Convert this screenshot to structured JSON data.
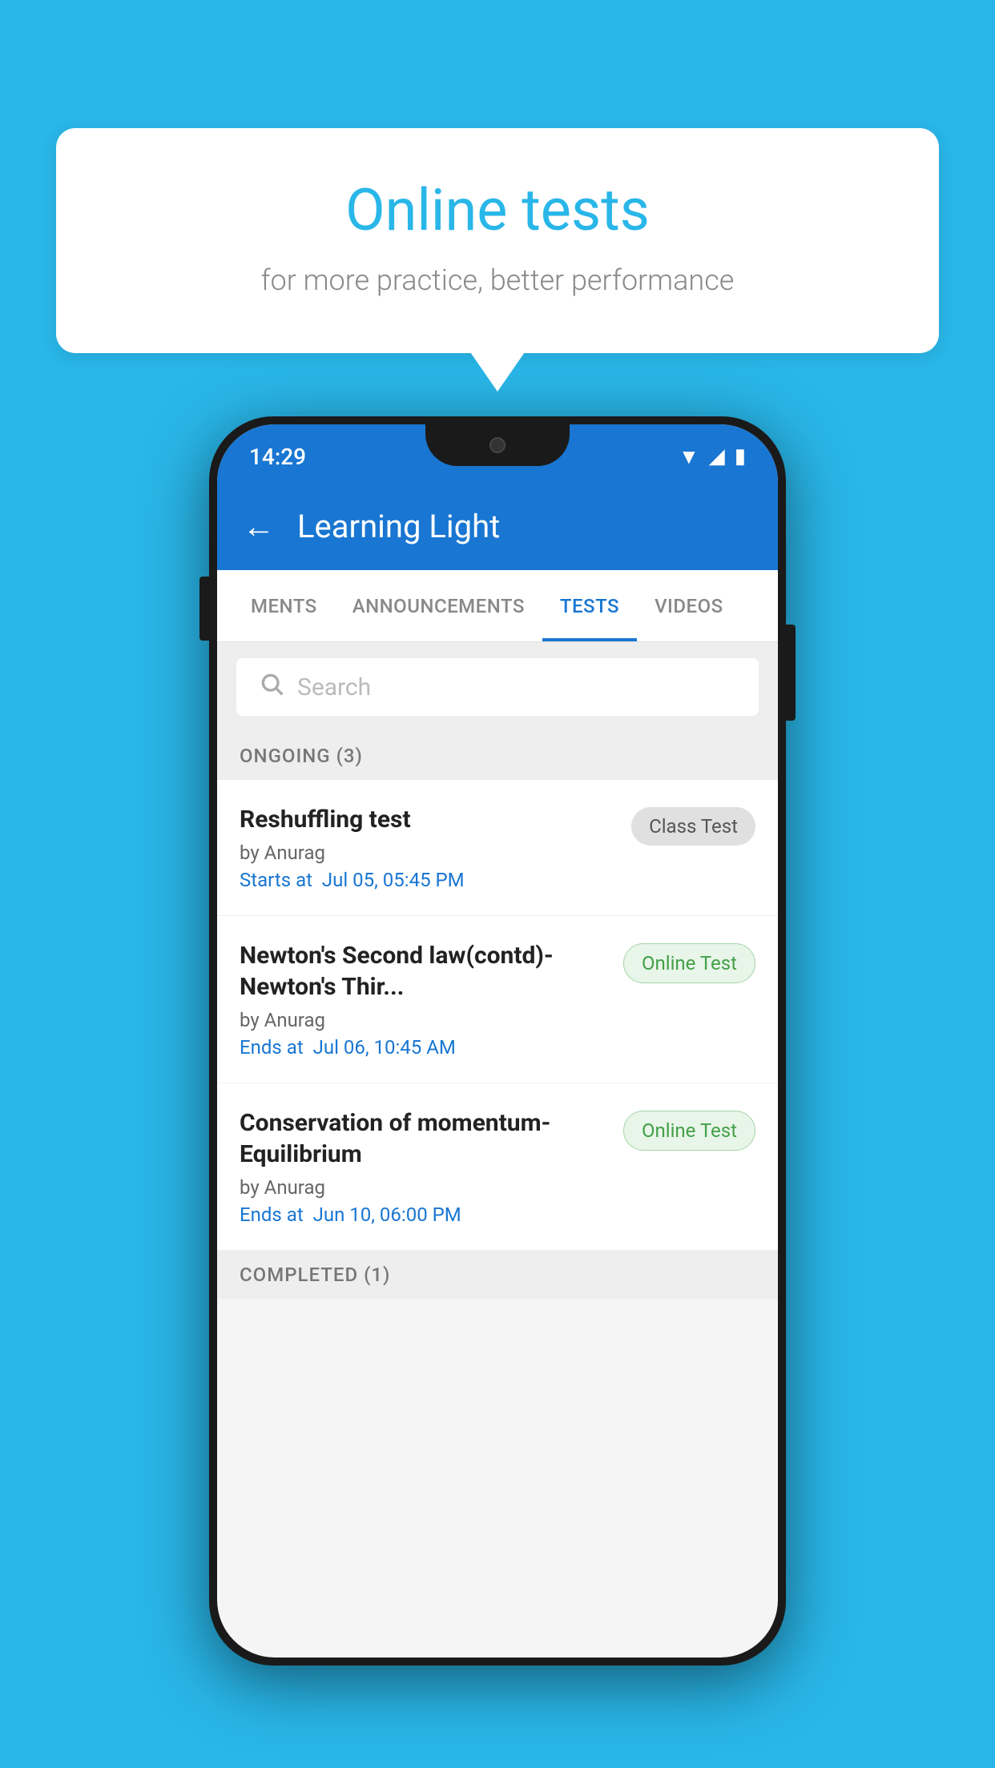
{
  "background": {
    "color": "#29b6e8"
  },
  "speech_bubble": {
    "title": "Online tests",
    "subtitle": "for more practice, better performance"
  },
  "phone": {
    "status_bar": {
      "time": "14:29",
      "icons": [
        "wifi",
        "signal",
        "battery"
      ]
    },
    "app_bar": {
      "title": "Learning Light",
      "back_label": "←"
    },
    "tabs": [
      {
        "label": "MENTS",
        "active": false
      },
      {
        "label": "ANNOUNCEMENTS",
        "active": false
      },
      {
        "label": "TESTS",
        "active": true
      },
      {
        "label": "VIDEOS",
        "active": false
      }
    ],
    "search": {
      "placeholder": "Search"
    },
    "sections": [
      {
        "label": "ONGOING (3)",
        "tests": [
          {
            "name": "Reshuffling test",
            "author": "by Anurag",
            "time_label": "Starts at",
            "time_value": "Jul 05, 05:45 PM",
            "badge": "Class Test",
            "badge_type": "class"
          },
          {
            "name": "Newton's Second law(contd)-Newton's Thir...",
            "author": "by Anurag",
            "time_label": "Ends at",
            "time_value": "Jul 06, 10:45 AM",
            "badge": "Online Test",
            "badge_type": "online"
          },
          {
            "name": "Conservation of momentum-Equilibrium",
            "author": "by Anurag",
            "time_label": "Ends at",
            "time_value": "Jun 10, 06:00 PM",
            "badge": "Online Test",
            "badge_type": "online"
          }
        ]
      }
    ],
    "completed_section_label": "COMPLETED (1)"
  }
}
